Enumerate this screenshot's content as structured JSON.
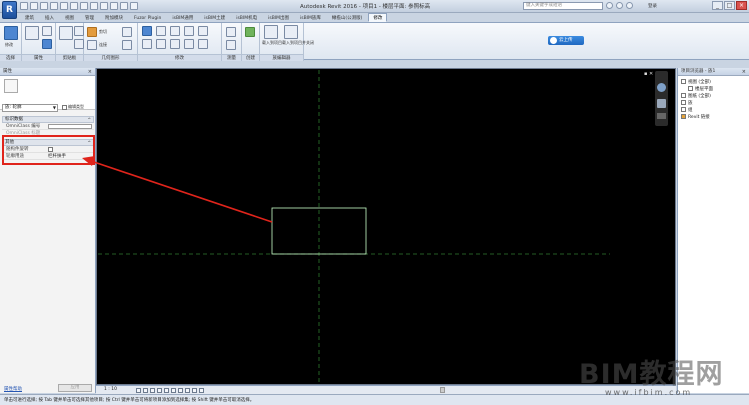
{
  "window": {
    "app_button": "R",
    "title": "Autodesk Revit 2016 -    项目1 - 楼层平面: 参照标高",
    "search_placeholder": "键入关键字或短语",
    "user": "登录",
    "controls": [
      "_",
      "□",
      "×"
    ]
  },
  "tabs": [
    {
      "label": "建筑"
    },
    {
      "label": "插入"
    },
    {
      "label": "视图"
    },
    {
      "label": "管理"
    },
    {
      "label": "附加模块"
    },
    {
      "label": "Fuzor Plugin"
    },
    {
      "label": "isBIM通用"
    },
    {
      "label": "isBIM土建"
    },
    {
      "label": "isBIM机电"
    },
    {
      "label": "isBIM出图"
    },
    {
      "label": "isBIM族库"
    },
    {
      "label": "橄榄山(公测版)"
    },
    {
      "label": "修改"
    }
  ],
  "ribbon": {
    "groups": [
      {
        "label": "选择"
      },
      {
        "label": "属性"
      },
      {
        "label": "剪贴板"
      },
      {
        "label": "几何图形"
      },
      {
        "label": "修改"
      },
      {
        "label": "测量"
      },
      {
        "label": "创建"
      },
      {
        "label": "族编辑器"
      }
    ],
    "buttons": {
      "modify": "修改",
      "cut": "剪切",
      "join": "连接",
      "load_project": "载入到项目",
      "load_close": "载入到项目并关闭"
    },
    "cloud_button": "云上传"
  },
  "properties": {
    "title": "属性",
    "type_selector": "族: 轮廓",
    "edit_type": "编辑类型",
    "sections": {
      "identity": "标识数据",
      "other": "其他"
    },
    "rows": {
      "omniclass_number": {
        "name": "OmniClass 编号",
        "value": ""
      },
      "omniclass_title": {
        "name": "OmniClass 标题",
        "value": ""
      },
      "follow_path": {
        "name": "随构件旋转",
        "value": ""
      },
      "profile_usage": {
        "name": "轮廓用途",
        "value": "栏杆扶手"
      }
    },
    "help": "属性帮助",
    "apply": "应用"
  },
  "project_browser": {
    "title": "项目浏览器 - 族1",
    "items": [
      {
        "label": "视图 (全部)"
      },
      {
        "label": "楼层平面"
      },
      {
        "label": "图纸 (全部)"
      },
      {
        "label": "族"
      },
      {
        "label": "组"
      },
      {
        "label": "Revit 链接"
      }
    ]
  },
  "view_bar": {
    "scale": "1 : 10"
  },
  "status": {
    "text": "单击可进行选择; 按 Tab 键并单击可选择其他项目; 按 Ctrl 键并单击可将新项目添加到选择集; 按 Shift 键并单击可取消选择。"
  },
  "watermark": {
    "main": "BIM教程网",
    "url": "www.ifbim.com"
  },
  "colors": {
    "highlight": "#e0241b",
    "canvas": "#000000",
    "rect_outline": "#c8ffc8",
    "ref_plane": "#2f7a2f"
  }
}
